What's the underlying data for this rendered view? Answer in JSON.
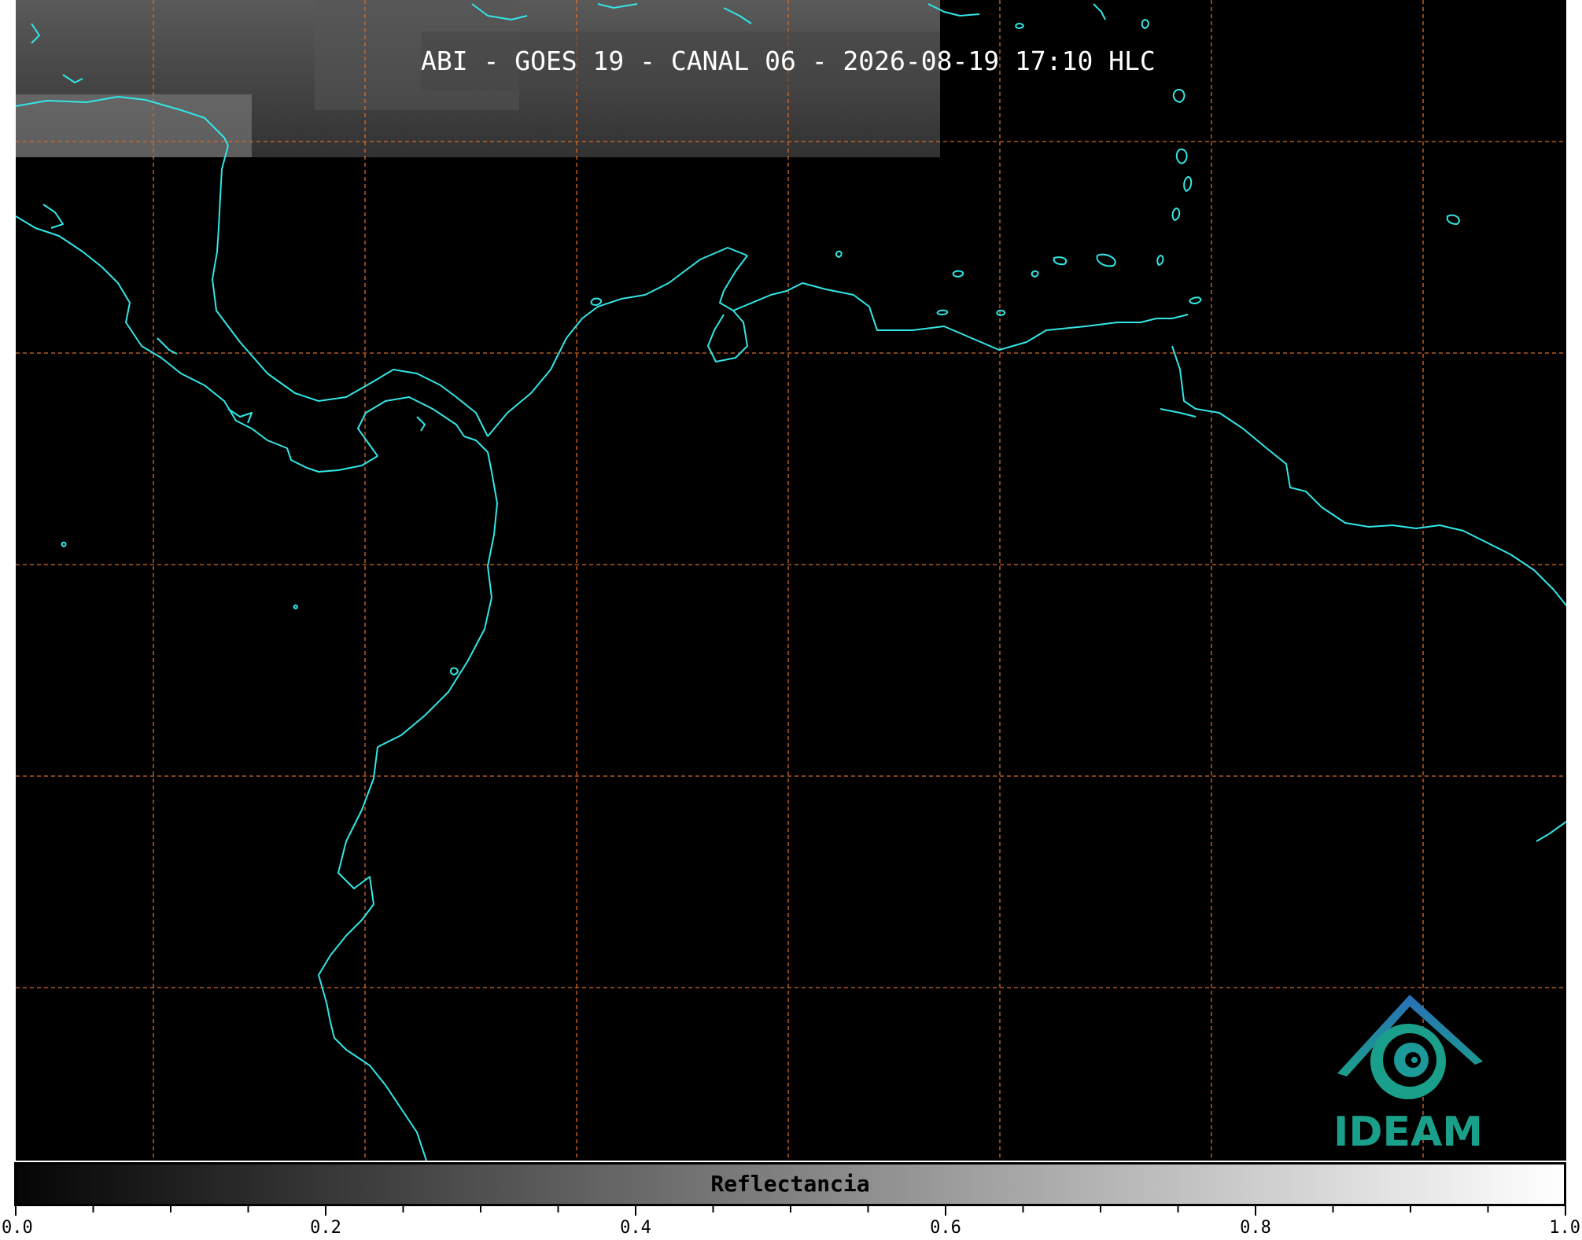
{
  "title": "ABI - GOES 19 - CANAL 06 - 2026-08-19 17:10 HLC",
  "colorbar": {
    "label": "Reflectancia",
    "min": 0.0,
    "max": 1.0,
    "major_ticks": [
      "0.0",
      "0.2",
      "0.4",
      "0.6",
      "0.8",
      "1.0"
    ],
    "colormap": "grayscale"
  },
  "logo": {
    "text": "IDEAM"
  },
  "colors": {
    "coastline": "#33e6e6",
    "grid": "#d86a2a",
    "background": "#000000",
    "logo_green": "#1aa08a",
    "logo_blue": "#2a6fb8"
  },
  "map": {
    "gridlines": true,
    "grid_style": "dashed"
  }
}
